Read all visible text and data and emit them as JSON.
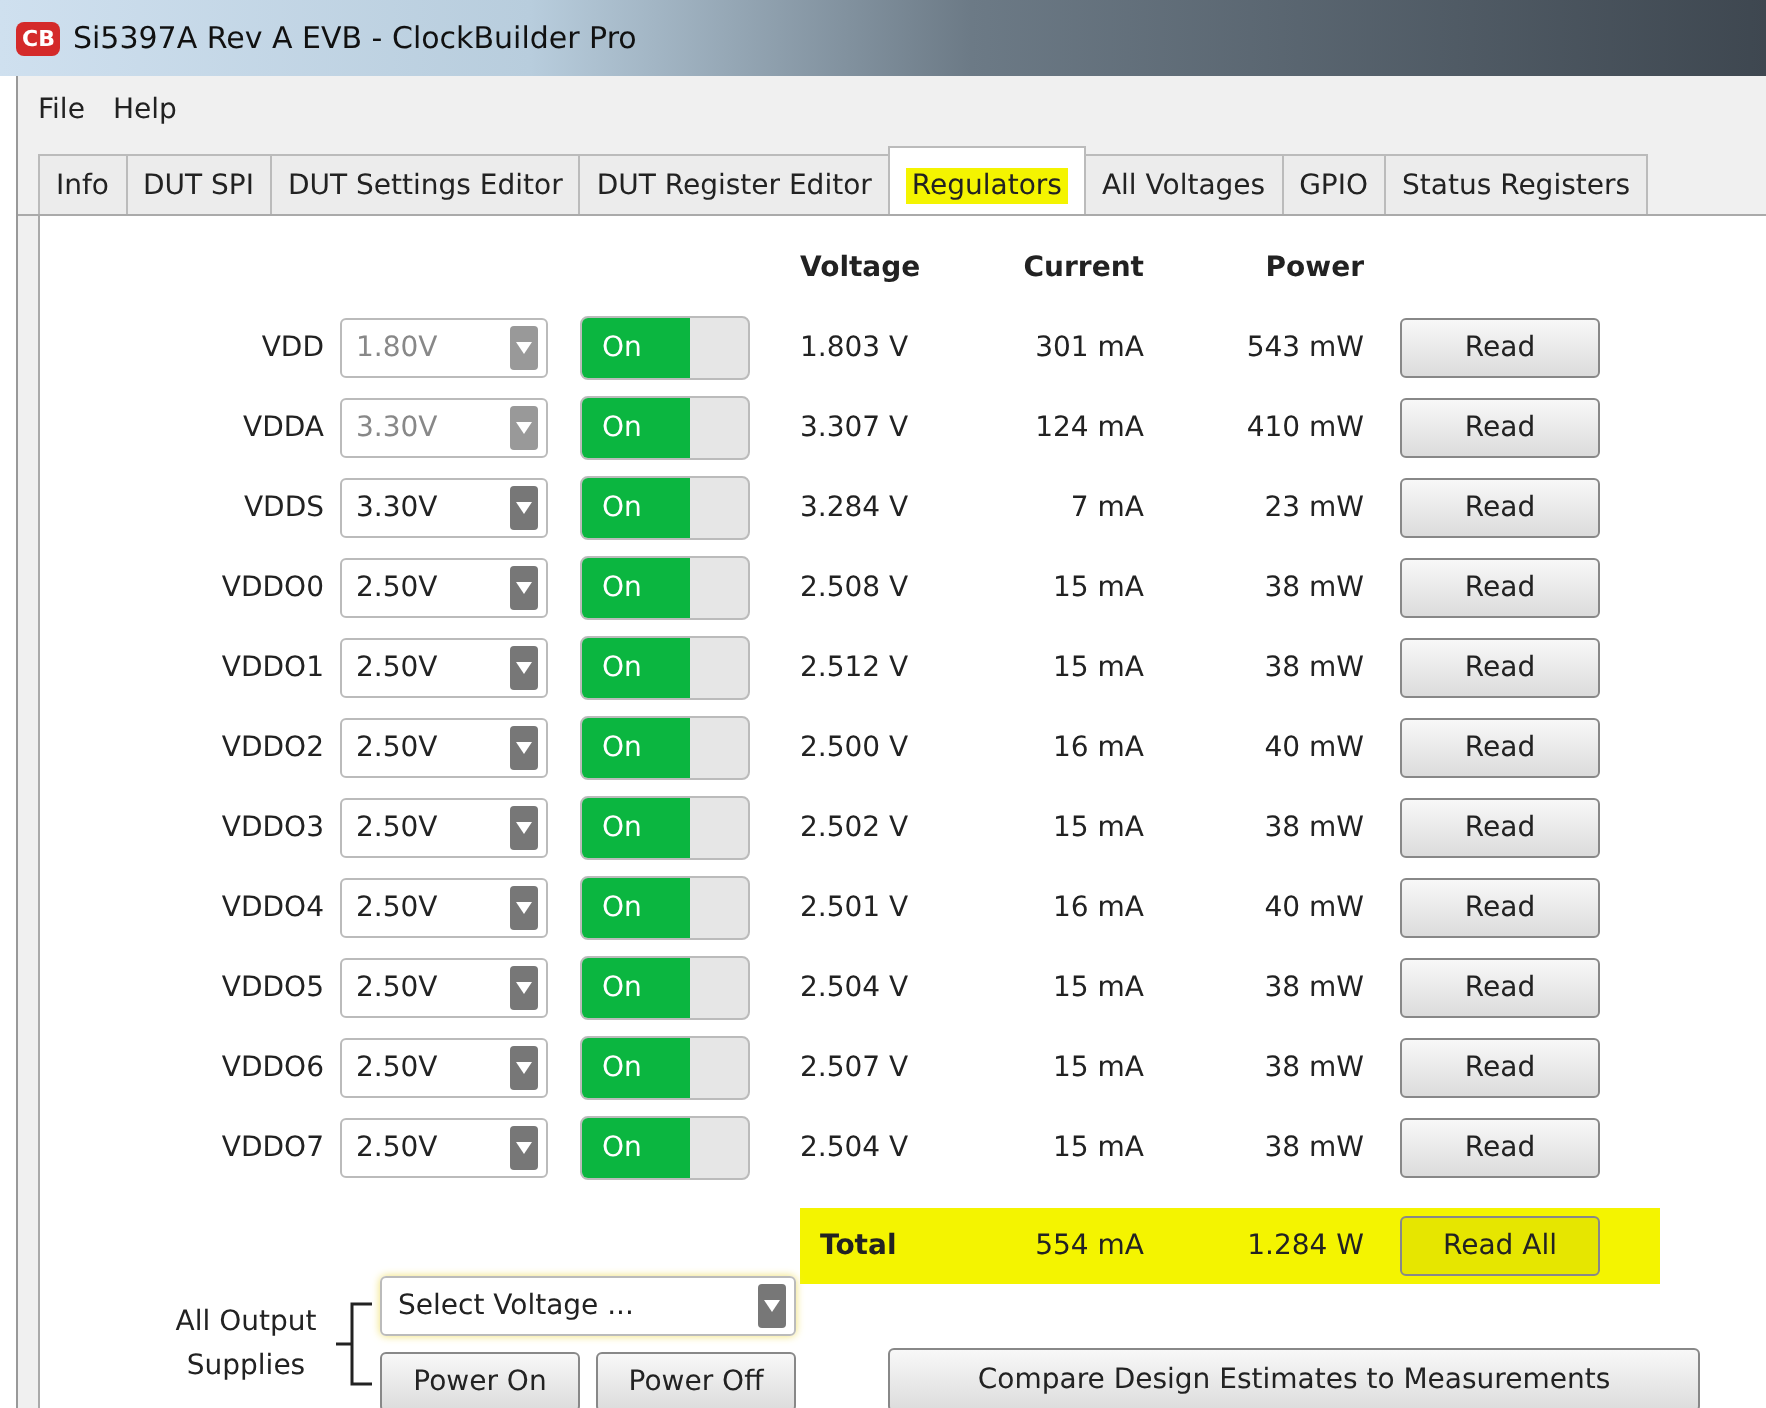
{
  "window": {
    "title": "Si5397A Rev A EVB - ClockBuilder Pro",
    "logo": "CB"
  },
  "menu": [
    "File",
    "Help"
  ],
  "tabs": [
    {
      "label": "Info",
      "selected": false,
      "highlighted": false
    },
    {
      "label": "DUT SPI",
      "selected": false,
      "highlighted": false
    },
    {
      "label": "DUT Settings Editor",
      "selected": false,
      "highlighted": false
    },
    {
      "label": "DUT Register Editor",
      "selected": false,
      "highlighted": false
    },
    {
      "label": "Regulators",
      "selected": true,
      "highlighted": true
    },
    {
      "label": "All Voltages",
      "selected": false,
      "highlighted": false
    },
    {
      "label": "GPIO",
      "selected": false,
      "highlighted": false
    },
    {
      "label": "Status Registers",
      "selected": false,
      "highlighted": false
    }
  ],
  "columns": [
    "Voltage",
    "Current",
    "Power"
  ],
  "regulators": [
    {
      "name": "VDD",
      "setting": "1.80V",
      "disabled": true,
      "switch": "On",
      "on": true,
      "voltage": "1.803 V",
      "current": "301 mA",
      "power": "543 mW",
      "button": "Read"
    },
    {
      "name": "VDDA",
      "setting": "3.30V",
      "disabled": true,
      "switch": "On",
      "on": true,
      "voltage": "3.307 V",
      "current": "124 mA",
      "power": "410 mW",
      "button": "Read"
    },
    {
      "name": "VDDS",
      "setting": "3.30V",
      "disabled": false,
      "switch": "On",
      "on": true,
      "voltage": "3.284 V",
      "current": "7 mA",
      "power": "23 mW",
      "button": "Read"
    },
    {
      "name": "VDDO0",
      "setting": "2.50V",
      "disabled": false,
      "switch": "On",
      "on": true,
      "voltage": "2.508 V",
      "current": "15 mA",
      "power": "38 mW",
      "button": "Read"
    },
    {
      "name": "VDDO1",
      "setting": "2.50V",
      "disabled": false,
      "switch": "On",
      "on": true,
      "voltage": "2.512 V",
      "current": "15 mA",
      "power": "38 mW",
      "button": "Read"
    },
    {
      "name": "VDDO2",
      "setting": "2.50V",
      "disabled": false,
      "switch": "On",
      "on": true,
      "voltage": "2.500 V",
      "current": "16 mA",
      "power": "40 mW",
      "button": "Read"
    },
    {
      "name": "VDDO3",
      "setting": "2.50V",
      "disabled": false,
      "switch": "On",
      "on": true,
      "voltage": "2.502 V",
      "current": "15 mA",
      "power": "38 mW",
      "button": "Read"
    },
    {
      "name": "VDDO4",
      "setting": "2.50V",
      "disabled": false,
      "switch": "On",
      "on": true,
      "voltage": "2.501 V",
      "current": "16 mA",
      "power": "40 mW",
      "button": "Read"
    },
    {
      "name": "VDDO5",
      "setting": "2.50V",
      "disabled": false,
      "switch": "On",
      "on": true,
      "voltage": "2.504 V",
      "current": "15 mA",
      "power": "38 mW",
      "button": "Read"
    },
    {
      "name": "VDDO6",
      "setting": "2.50V",
      "disabled": false,
      "switch": "On",
      "on": true,
      "voltage": "2.507 V",
      "current": "15 mA",
      "power": "38 mW",
      "button": "Read"
    },
    {
      "name": "VDDO7",
      "setting": "2.50V",
      "disabled": false,
      "switch": "On",
      "on": true,
      "voltage": "2.504 V",
      "current": "15 mA",
      "power": "38 mW",
      "button": "Read"
    }
  ],
  "total": {
    "label": "Total",
    "current": "554 mA",
    "power": "1.284 W",
    "button": "Read All",
    "highlighted": true
  },
  "all_outputs": {
    "label": "All Output Supplies",
    "select": {
      "placeholder": "Select Voltage ..."
    },
    "buttons": [
      "Power On",
      "Power Off"
    ]
  },
  "compare_button": "Compare Design Estimates to Measurements"
}
